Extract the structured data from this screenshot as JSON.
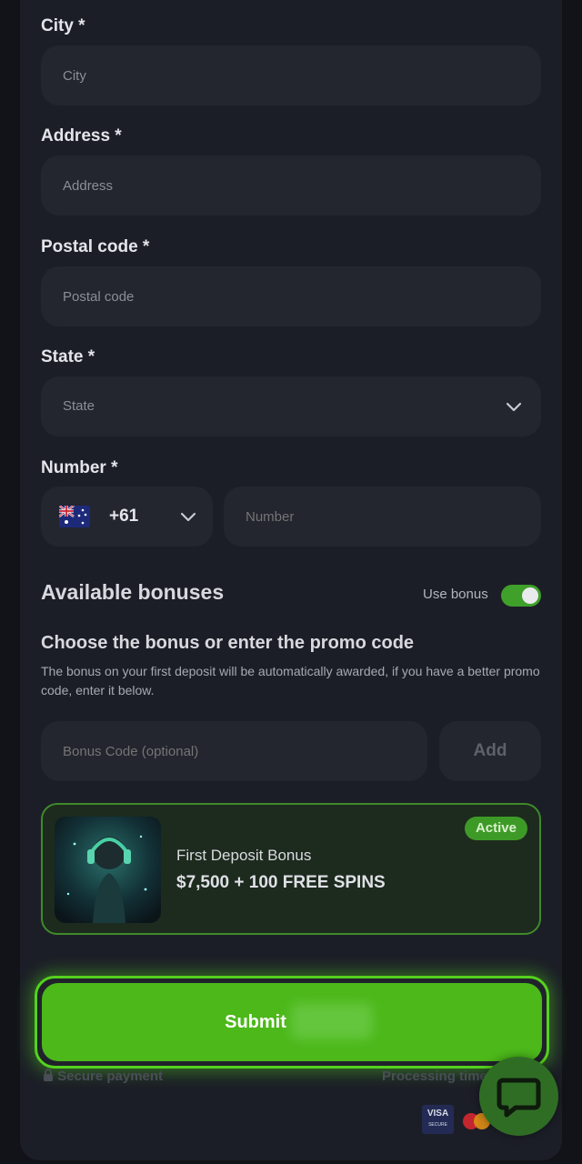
{
  "form": {
    "city": {
      "label": "City *",
      "placeholder": "City"
    },
    "address": {
      "label": "Address *",
      "placeholder": "Address"
    },
    "postal": {
      "label": "Postal code *",
      "placeholder": "Postal code"
    },
    "state": {
      "label": "State *",
      "value": "State"
    },
    "number": {
      "label": "Number *",
      "country_code": "+61",
      "placeholder": "Number"
    }
  },
  "bonuses": {
    "title": "Available bonuses",
    "toggle_label": "Use bonus",
    "toggle_on": true,
    "subtitle": "Choose the bonus or enter the promo code",
    "description": "The bonus on your first deposit will be automatically awarded, if you have a better promo code, enter it below.",
    "code_placeholder": "Bonus Code (optional)",
    "add_label": "Add",
    "card": {
      "name": "First Deposit Bonus",
      "amount": "$7,500 + 100 FREE SPINS",
      "badge": "Active"
    }
  },
  "submit": {
    "label": "Submit"
  },
  "footer": {
    "secure": "Secure payment",
    "processing": "Processing time",
    "visa": "VISA",
    "visa_sub": "SECURE"
  },
  "colors": {
    "accent": "#4cb81a",
    "panel": "#1c1e27",
    "input": "#23252f"
  },
  "icons": [
    "chevron-down-icon",
    "australia-flag-icon",
    "lock-icon",
    "chat-icon",
    "mastercard-icon"
  ]
}
